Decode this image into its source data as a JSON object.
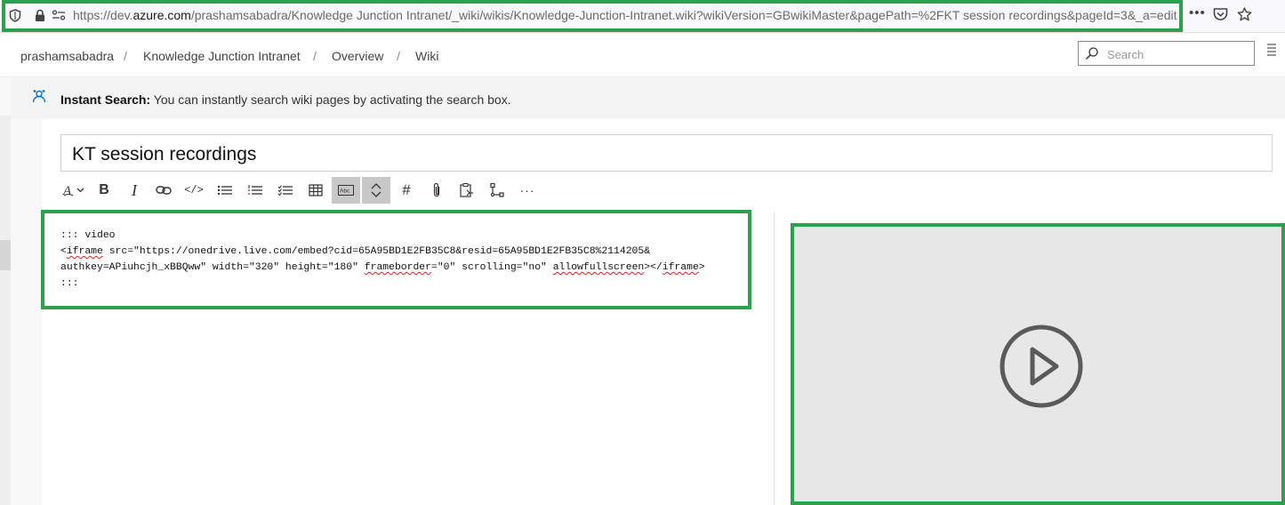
{
  "browser": {
    "url_scheme": "https://dev.",
    "url_host": "azure.com",
    "url_path": "/prashamsabadra/Knowledge Junction Intranet/_wiki/wikis/Knowledge-Junction-Intranet.wiki?wikiVersion=GBwikiMaster&pagePath=%2FKT session recordings&pageId=3&_a=edit",
    "icons": [
      "shield-icon",
      "lock-icon",
      "permissions-icon",
      "more-icon",
      "pocket-icon",
      "star-icon"
    ]
  },
  "breadcrumb": {
    "items": [
      "prashamsabadra",
      "Knowledge Junction Intranet",
      "Overview",
      "Wiki"
    ],
    "separator": "/"
  },
  "search": {
    "placeholder": "Search"
  },
  "info": {
    "label": "Instant Search:",
    "message": " You can instantly search wiki pages by activating the search box."
  },
  "page": {
    "title": "KT session recordings"
  },
  "toolbar": {
    "buttons": [
      "format-icon",
      "bold-icon",
      "italic-icon",
      "link-icon",
      "code-icon",
      "bulleted-list-icon",
      "numbered-list-icon",
      "checklist-icon",
      "table-icon",
      "abc-icon",
      "toggle-icon",
      "heading-icon",
      "attach-icon",
      "paste-icon",
      "mermaid-icon",
      "more-icon"
    ],
    "format_glyph": "A",
    "bold_glyph": "B",
    "italic_glyph": "I",
    "code_glyph": "</>",
    "heading_glyph": "#",
    "more_glyph": "···",
    "abc_glyph": "Abc",
    "active": [
      "abc-icon",
      "toggle-icon"
    ]
  },
  "editor": {
    "line1": "::: video",
    "line2_a": "<",
    "line2_sq": "iframe",
    "line2_b": " src=\"https://onedrive.live.com/embed?cid=65A95BD1E2FB35C8&resid=65A95BD1E2FB35C8%2114205&",
    "line3_a": "authkey=APiuhcjh_xBBQww\" width=\"320\" height=\"180\" ",
    "line3_sq1": "frameborder",
    "line3_b": "=\"0\" scrolling=\"no\" ",
    "line3_sq2": "allowfullscreen",
    "line3_c": "></",
    "line3_sq3": "iframe",
    "line3_d": ">",
    "line4": ":::"
  },
  "preview": {
    "icon": "play-icon",
    "background": "#e7e7e7"
  },
  "colors": {
    "highlight_frame": "#2ca04d",
    "squiggle": "#e02020"
  }
}
